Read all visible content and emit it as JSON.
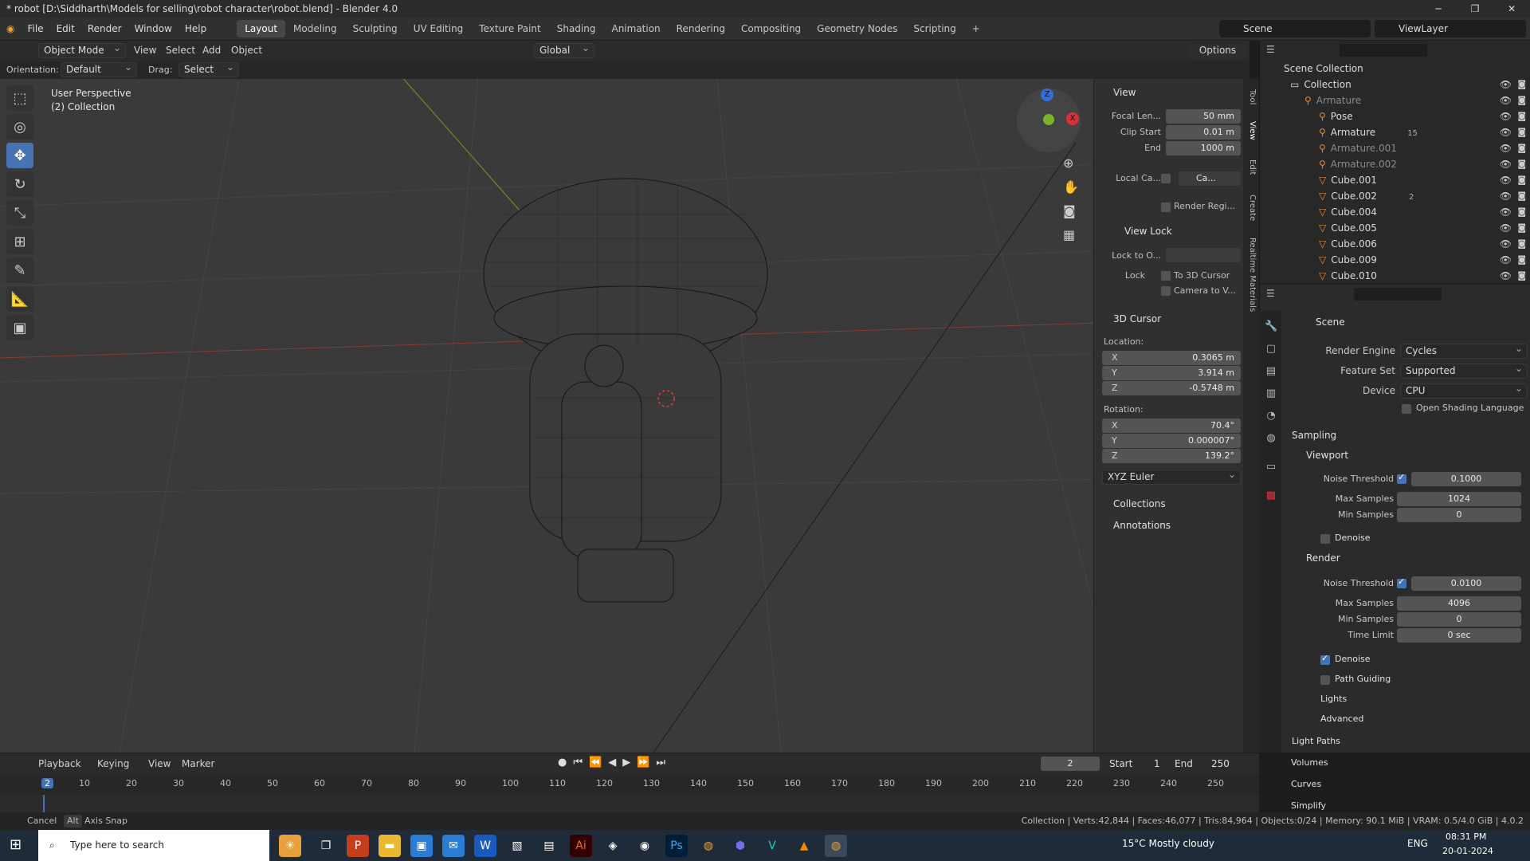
{
  "window": {
    "title": "* robot [D:\\Siddharth\\Models for selling\\robot character\\robot.blend] - Blender 4.0",
    "minimize": "─",
    "maximize": "❐",
    "close": "✕"
  },
  "menu": {
    "items": [
      "File",
      "Edit",
      "Render",
      "Window",
      "Help"
    ],
    "workspaces": [
      "Layout",
      "Modeling",
      "Sculpting",
      "UV Editing",
      "Texture Paint",
      "Shading",
      "Animation",
      "Rendering",
      "Compositing",
      "Geometry Nodes",
      "Scripting"
    ],
    "active_workspace": "Layout",
    "add_tab": "+"
  },
  "scene_selector": {
    "scene": "Scene",
    "view_layer": "ViewLayer"
  },
  "viewport_header": {
    "mode": "Object Mode",
    "menus": [
      "View",
      "Select",
      "Add",
      "Object"
    ],
    "transform": "Global",
    "options": "Options",
    "orientation_label": "Orientation:",
    "orientation": "Default",
    "drag_label": "Drag:",
    "drag": "Select Box"
  },
  "viewport": {
    "overlay_line1": "User Perspective",
    "overlay_line2": "(2) Collection",
    "gizmo": {
      "z": "Z",
      "x": "X"
    }
  },
  "npanel": {
    "tabs": [
      "Tool",
      "View",
      "Edit",
      "Create",
      "Realtime Materials"
    ],
    "view_title": "View",
    "focal_label": "Focal Len...",
    "focal": "50 mm",
    "clip_start_label": "Clip Start",
    "clip_start": "0.01 m",
    "clip_end_label": "End",
    "clip_end": "1000 m",
    "local_cam_label": "Local Ca...",
    "local_cam": "Ca...",
    "render_region": "Render Regi...",
    "view_lock_title": "View Lock",
    "lock_obj_label": "Lock to O...",
    "lock_label": "Lock",
    "to_cursor": "To 3D Cursor",
    "camera_to_view": "Camera to V...",
    "cursor_title": "3D Cursor",
    "location_label": "Location:",
    "loc_x": "0.3065 m",
    "loc_y": "3.914 m",
    "loc_z": "-0.5748 m",
    "rotation_label": "Rotation:",
    "rot_x": "70.4°",
    "rot_y": "0.000007°",
    "rot_z": "139.2°",
    "axis_x": "X",
    "axis_y": "Y",
    "axis_z": "Z",
    "euler": "XYZ Euler",
    "collections": "Collections",
    "annotations": "Annotations"
  },
  "outliner": {
    "scene_collection": "Scene Collection",
    "rows": [
      {
        "name": "Collection",
        "indent": 1
      },
      {
        "name": "Armature",
        "indent": 2,
        "dim": true
      },
      {
        "name": "Pose",
        "indent": 3
      },
      {
        "name": "Armature",
        "indent": 3,
        "extra": "15"
      },
      {
        "name": "Armature.001",
        "indent": 3,
        "dim": true
      },
      {
        "name": "Armature.002",
        "indent": 3,
        "dim": true
      },
      {
        "name": "Cube.001",
        "indent": 3
      },
      {
        "name": "Cube.002",
        "indent": 3,
        "extra": "2"
      },
      {
        "name": "Cube.004",
        "indent": 3
      },
      {
        "name": "Cube.005",
        "indent": 3
      },
      {
        "name": "Cube.006",
        "indent": 3
      },
      {
        "name": "Cube.009",
        "indent": 3
      },
      {
        "name": "Cube.010",
        "indent": 3
      }
    ]
  },
  "properties": {
    "context": "Scene",
    "render_engine_label": "Render Engine",
    "render_engine": "Cycles",
    "feature_set_label": "Feature Set",
    "feature_set": "Supported",
    "device_label": "Device",
    "device": "CPU",
    "osl": "Open Shading Language",
    "sampling": "Sampling",
    "viewport": "Viewport",
    "noise_threshold_label": "Noise Threshold",
    "vp_noise": "0.1000",
    "max_samples_label": "Max Samples",
    "vp_max": "1024",
    "min_samples_label": "Min Samples",
    "vp_min": "0",
    "denoise": "Denoise",
    "render": "Render",
    "r_noise": "0.0100",
    "r_max": "4096",
    "r_min": "0",
    "time_limit_label": "Time Limit",
    "time_limit": "0 sec",
    "path_guiding": "Path Guiding",
    "lights": "Lights",
    "advanced": "Advanced",
    "light_paths": "Light Paths",
    "volumes": "Volumes",
    "curves": "Curves",
    "simplify": "Simplify"
  },
  "timeline": {
    "menus": [
      "Playback",
      "Keying",
      "View",
      "Marker"
    ],
    "current": "2",
    "start_label": "Start",
    "start": "1",
    "end_label": "End",
    "end": "250",
    "ticks": [
      "2",
      "10",
      "20",
      "30",
      "40",
      "50",
      "60",
      "70",
      "80",
      "90",
      "100",
      "110",
      "120",
      "130",
      "140",
      "150",
      "160",
      "170",
      "180",
      "190",
      "200",
      "210",
      "220",
      "230",
      "240",
      "250"
    ]
  },
  "status": {
    "cancel": "Cancel",
    "alt": "Alt",
    "axis_snap": "Axis Snap",
    "stats": "Collection | Verts:42,844 | Faces:46,077 | Tris:84,964 | Objects:0/24 | Memory: 90.1 MiB | VRAM: 0.5/4.0 GiB | 4.0.2"
  },
  "taskbar": {
    "search_placeholder": "Type here to search",
    "weather": "15°C  Mostly cloudy",
    "lang": "ENG",
    "time": "08:31 PM",
    "date": "20-01-2024"
  }
}
